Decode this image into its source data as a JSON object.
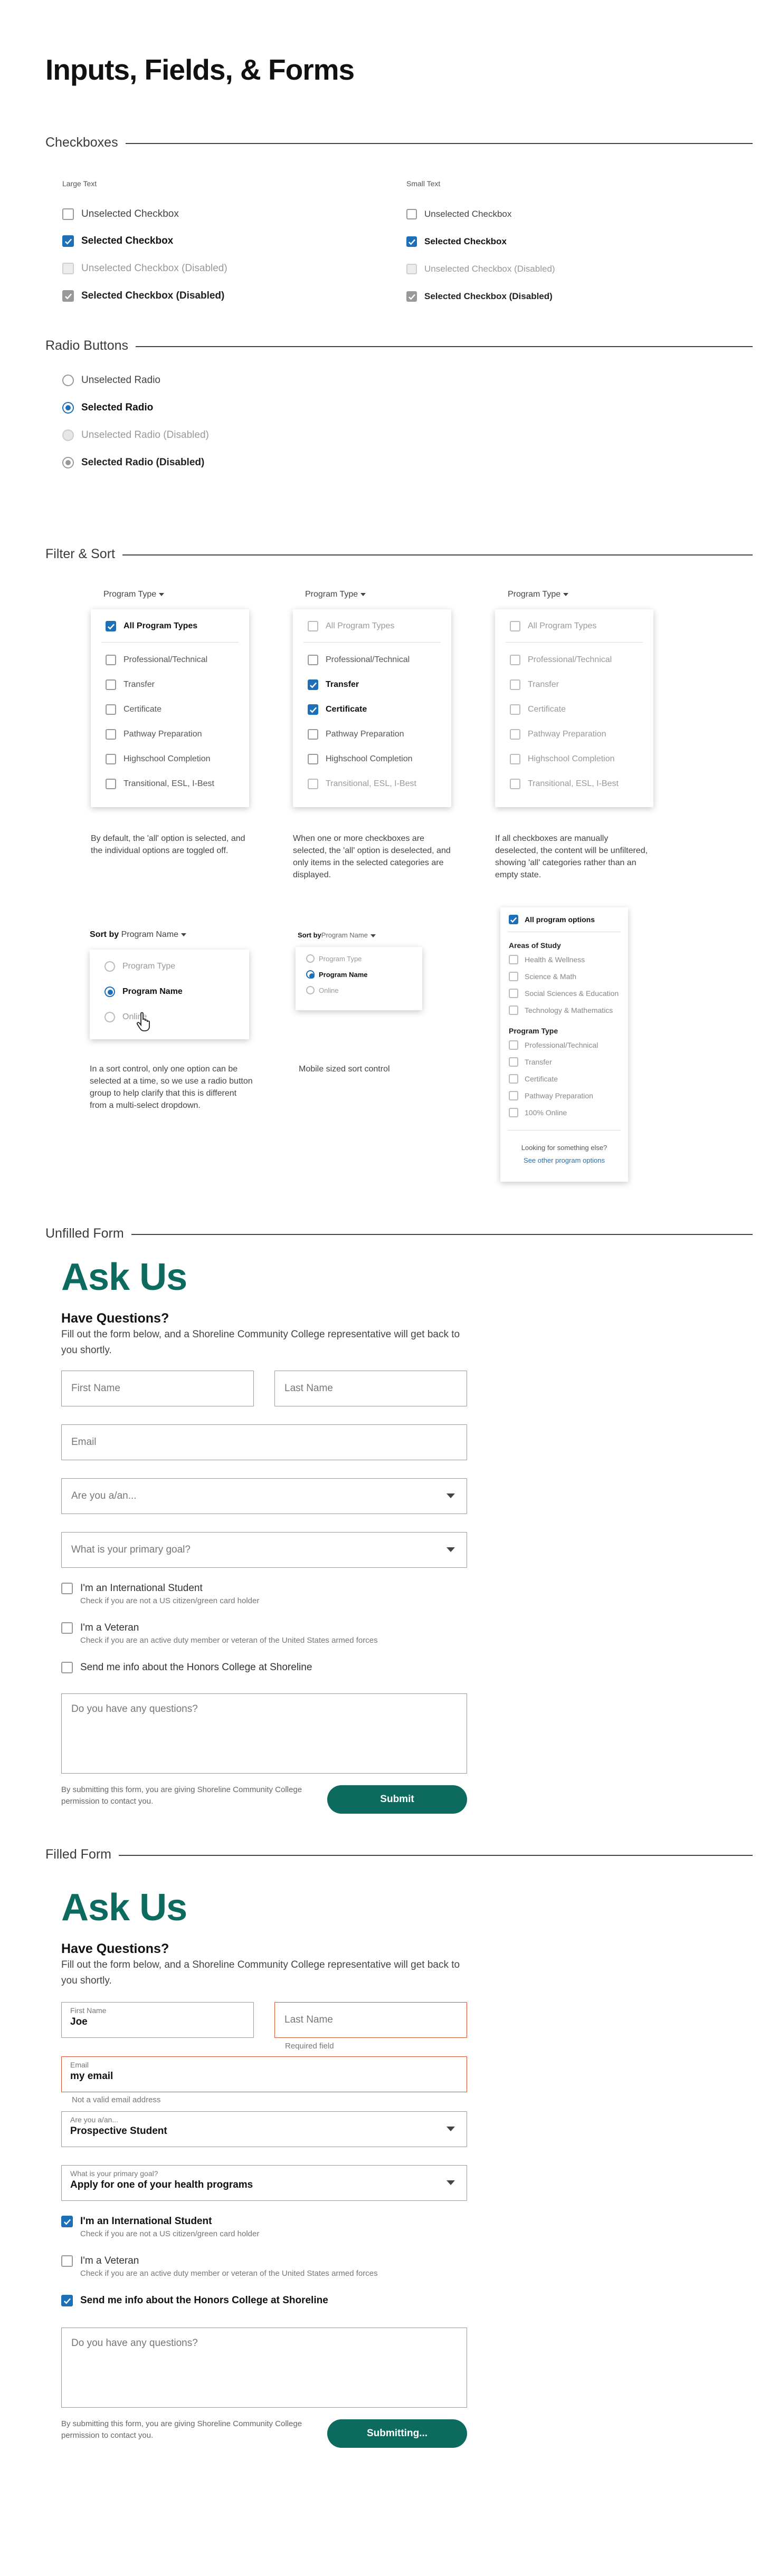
{
  "page_title": "Inputs, Fields, & Forms",
  "sections": {
    "checkboxes": "Checkboxes",
    "radios": "Radio Buttons",
    "filter_sort": "Filter & Sort",
    "unfilled": "Unfilled Form",
    "filled": "Filled Form"
  },
  "checkboxes": {
    "large_label": "Large Text",
    "small_label": "Small Text",
    "items": [
      {
        "label": "Unselected Checkbox",
        "state": "off"
      },
      {
        "label": "Selected Checkbox",
        "state": "on"
      },
      {
        "label": "Unselected Checkbox (Disabled)",
        "state": "dis"
      },
      {
        "label": "Selected Checkbox (Disabled)",
        "state": "dison"
      }
    ]
  },
  "radios": {
    "items": [
      {
        "label": "Unselected Radio",
        "state": "off"
      },
      {
        "label": "Selected Radio",
        "state": "on"
      },
      {
        "label": "Unselected Radio (Disabled)",
        "state": "dis"
      },
      {
        "label": "Selected Radio (Disabled)",
        "state": "dison"
      }
    ]
  },
  "filter": {
    "dropdown_label": "Program Type",
    "col1": {
      "all": "All Program Types",
      "options": [
        "Professional/Technical",
        "Transfer",
        "Certificate",
        "Pathway Preparation",
        "Highschool Completion",
        "Transitional, ESL, I-Best"
      ],
      "desc": "By default, the 'all' option is selected, and the individual options are toggled off."
    },
    "col2": {
      "all": "All Program Types",
      "options": [
        "Professional/Technical",
        "Transfer",
        "Certificate",
        "Pathway Preparation",
        "Highschool Completion",
        "Transitional, ESL, I-Best"
      ],
      "desc": "When one or more checkboxes are selected, the 'all' option is deselected, and only items in the selected categories are displayed."
    },
    "col3": {
      "all": "All Program Types",
      "options": [
        "Professional/Technical",
        "Transfer",
        "Certificate",
        "Pathway Preparation",
        "Highschool Completion",
        "Transitional, ESL, I-Best"
      ],
      "desc": "If all checkboxes are manually deselected, the content will be unfiltered, showing 'all' categories rather than an empty state."
    },
    "sort_by": "Sort by",
    "sort_value": "Program Name",
    "sort_options": [
      "Program Type",
      "Program Name",
      "Online"
    ],
    "sort_desc": "In a sort control, only one option can be selected at a time, so we use a radio button group to help clarify that this is different from a multi-select dropdown.",
    "mobile_desc": "Mobile sized sort control",
    "all_program_options": "All program options",
    "areas_heading": "Areas of Study",
    "areas": [
      "Health & Wellness",
      "Science & Math",
      "Social Sciences & Education",
      "Technology & Mathematics"
    ],
    "ptype_heading": "Program Type",
    "ptypes": [
      "Professional/Technical",
      "Transfer",
      "Certificate",
      "Pathway Preparation",
      "100% Online"
    ],
    "looking": "Looking for something else?",
    "see_other": "See other program options"
  },
  "form": {
    "heading": "Ask Us",
    "subheading": "Have Questions?",
    "intro": "Fill out the form below, and a Shoreline Community College representative will get back to you shortly.",
    "first_name": "First Name",
    "last_name": "Last Name",
    "email": "Email",
    "are_you": "Are you a/an...",
    "goal": "What is your primary goal?",
    "intl_title": "I'm an International Student",
    "intl_help": "Check if you are not a US citizen/green card holder",
    "vet_title": "I'm a Veteran",
    "vet_help": "Check if you are an active duty member or veteran of the United States armed forces",
    "honors": "Send me info about the Honors College at Shoreline",
    "questions": "Do you have any questions?",
    "disclaimer": "By submitting this form, you are giving Shoreline Community College permission to contact you.",
    "submit": "Submit"
  },
  "filled": {
    "first_value": "Joe",
    "required": "Required field",
    "email_value": "my email",
    "invalid_email": "Not a valid email address",
    "are_you_value": "Prospective Student",
    "goal_value": "Apply for one of your health programs",
    "submitting": "Submitting..."
  },
  "colors": {
    "brand": "#0c6b5e",
    "accent": "#1d6fb8",
    "error": "#d9542b"
  }
}
